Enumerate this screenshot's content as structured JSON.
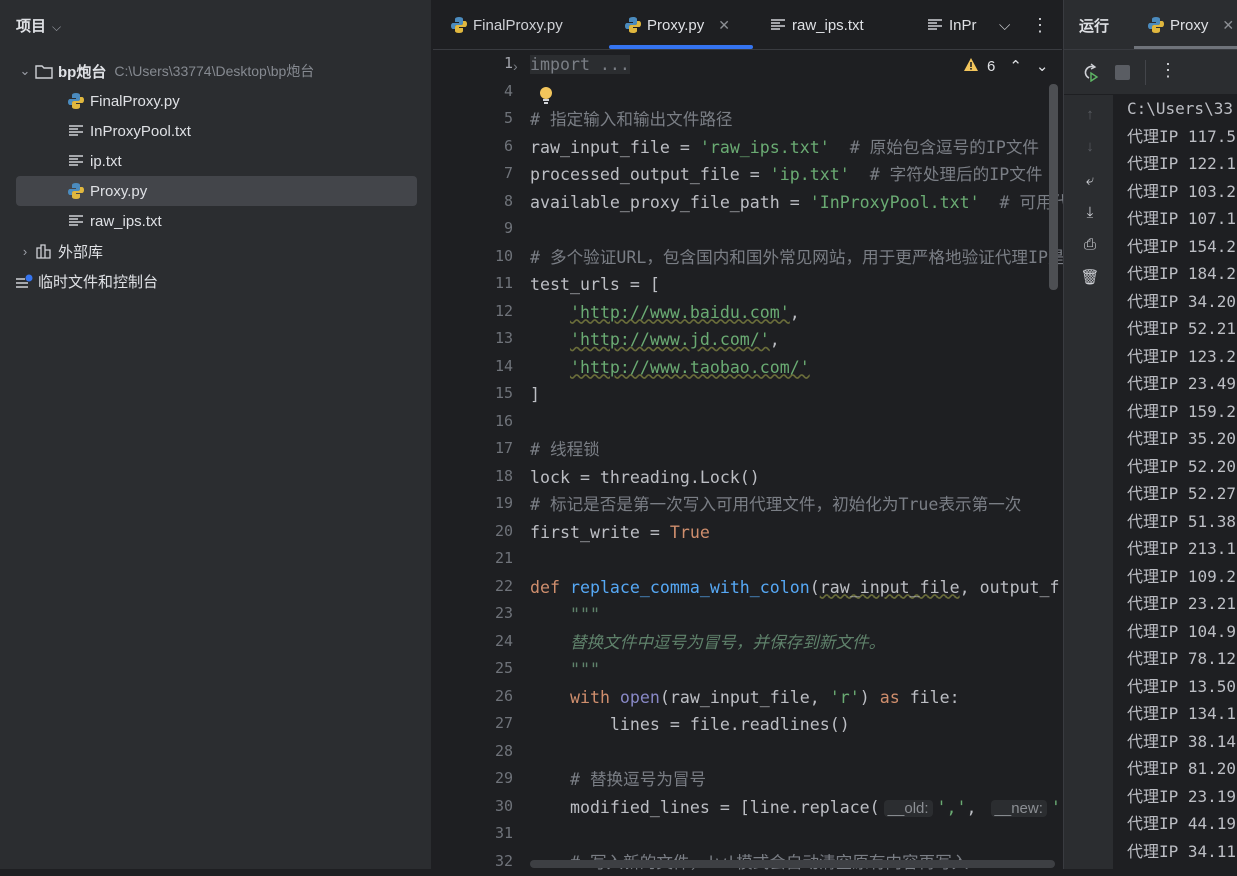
{
  "project": {
    "title": "项目",
    "root": {
      "name": "bp炮台",
      "path": "C:\\Users\\33774\\Desktop\\bp炮台"
    },
    "files": [
      {
        "name": "FinalProxy.py",
        "type": "python"
      },
      {
        "name": "InProxyPool.txt",
        "type": "text"
      },
      {
        "name": "ip.txt",
        "type": "text"
      },
      {
        "name": "Proxy.py",
        "type": "python",
        "selected": true
      },
      {
        "name": "raw_ips.txt",
        "type": "text"
      }
    ],
    "external_libs": "外部库",
    "scratches": "临时文件和控制台"
  },
  "editor": {
    "tabs": [
      {
        "label": "FinalProxy.py",
        "type": "python"
      },
      {
        "label": "Proxy.py",
        "type": "python",
        "active": true
      },
      {
        "label": "raw_ips.txt",
        "type": "text"
      },
      {
        "label": "InPr",
        "type": "text"
      }
    ],
    "warnings_count": "6",
    "lines": [
      {
        "n": "1",
        "t": [
          [
            "fold",
            "import ..."
          ]
        ]
      },
      {
        "n": "4",
        "t": []
      },
      {
        "n": "5",
        "t": [
          [
            "c",
            "# 指定输入和输出文件路径"
          ]
        ]
      },
      {
        "n": "6",
        "t": [
          [
            "p",
            "raw_input_file = "
          ],
          [
            "s",
            "'raw_ips.txt'"
          ],
          [
            "c",
            "  # 原始包含逗号的IP文件"
          ]
        ]
      },
      {
        "n": "7",
        "t": [
          [
            "p",
            "processed_output_file = "
          ],
          [
            "s",
            "'ip.txt'"
          ],
          [
            "c",
            "  # 字符处理后的IP文件"
          ]
        ]
      },
      {
        "n": "8",
        "t": [
          [
            "p",
            "available_proxy_file_path = "
          ],
          [
            "s",
            "'InProxyPool.txt'"
          ],
          [
            "c",
            "  # 可用代"
          ]
        ]
      },
      {
        "n": "9",
        "t": []
      },
      {
        "n": "10",
        "t": [
          [
            "c",
            "# 多个验证URL，包含国内和国外常见网站，用于更严格地验证代理IP是否"
          ]
        ]
      },
      {
        "n": "11",
        "t": [
          [
            "p",
            "test_urls = ["
          ]
        ]
      },
      {
        "n": "12",
        "t": [
          [
            "p",
            "    "
          ],
          [
            "s u",
            "'http://www.baidu.com'"
          ],
          [
            "p",
            ","
          ]
        ]
      },
      {
        "n": "13",
        "t": [
          [
            "p",
            "    "
          ],
          [
            "s u",
            "'http://www.jd.com/'"
          ],
          [
            "p",
            ","
          ]
        ]
      },
      {
        "n": "14",
        "t": [
          [
            "p",
            "    "
          ],
          [
            "s u",
            "'http://www.taobao.com/'"
          ]
        ]
      },
      {
        "n": "15",
        "t": [
          [
            "p",
            "]"
          ]
        ]
      },
      {
        "n": "16",
        "t": []
      },
      {
        "n": "17",
        "t": [
          [
            "c",
            "# 线程锁"
          ]
        ]
      },
      {
        "n": "18",
        "t": [
          [
            "p",
            "lock = threading.Lock()"
          ]
        ]
      },
      {
        "n": "19",
        "t": [
          [
            "c",
            "# 标记是否是第一次写入可用代理文件，初始化为True表示第一次"
          ]
        ]
      },
      {
        "n": "20",
        "t": [
          [
            "p",
            "first_write = "
          ],
          [
            "k",
            "True"
          ]
        ]
      },
      {
        "n": "21",
        "t": []
      },
      {
        "n": "22",
        "t": [
          [
            "k",
            "def "
          ],
          [
            "f",
            "replace_comma_with_colon"
          ],
          [
            "p",
            "("
          ],
          [
            "p u",
            "raw_input_file"
          ],
          [
            "p",
            ", output_f"
          ]
        ]
      },
      {
        "n": "23",
        "t": [
          [
            "d",
            "    \"\"\""
          ]
        ]
      },
      {
        "n": "24",
        "t": [
          [
            "d",
            "    替换文件中逗号为冒号，并保存到新文件。"
          ]
        ]
      },
      {
        "n": "25",
        "t": [
          [
            "d",
            "    \"\"\""
          ]
        ]
      },
      {
        "n": "26",
        "t": [
          [
            "p",
            "    "
          ],
          [
            "k",
            "with "
          ],
          [
            "b",
            "open"
          ],
          [
            "p",
            "(raw_input_file, "
          ],
          [
            "s",
            "'r'"
          ],
          [
            "p",
            ") "
          ],
          [
            "k",
            "as "
          ],
          [
            "p",
            "file:"
          ]
        ]
      },
      {
        "n": "27",
        "t": [
          [
            "p",
            "        lines = file.readlines()"
          ]
        ]
      },
      {
        "n": "28",
        "t": []
      },
      {
        "n": "29",
        "t": [
          [
            "c",
            "    # 替换逗号为冒号"
          ]
        ]
      },
      {
        "n": "30",
        "t": [
          [
            "p",
            "    modified_lines = [line.replace("
          ],
          [
            "h",
            "__old:"
          ],
          [
            "s",
            "','"
          ],
          [
            "p",
            ", "
          ],
          [
            "h",
            "__new:"
          ],
          [
            "s",
            "'"
          ]
        ]
      },
      {
        "n": "31",
        "t": []
      },
      {
        "n": "32",
        "t": [
          [
            "c",
            "    # 写入新的文件，'w'模式会自动清空原有内容再写入"
          ]
        ]
      }
    ]
  },
  "run": {
    "title": "运行",
    "tab": "Proxy",
    "console": [
      "C:\\Users\\33",
      "代理IP 117.5",
      "代理IP 122.1",
      "代理IP 103.2",
      "代理IP 107.1",
      "代理IP 154.2",
      "代理IP 184.2",
      "代理IP 34.20",
      "代理IP 52.21",
      "代理IP 123.2",
      "代理IP 23.49",
      "代理IP 159.2",
      "代理IP 35.20",
      "代理IP 52.20",
      "代理IP 52.27",
      "代理IP 51.38",
      "代理IP 213.1",
      "代理IP 109.2",
      "代理IP 23.21",
      "代理IP 104.9",
      "代理IP 78.12",
      "代理IP 13.50",
      "代理IP 134.1",
      "代理IP 38.14",
      "代理IP 81.20",
      "代理IP 23.19",
      "代理IP 44.19",
      "代理IP 34.11"
    ]
  },
  "colors": {
    "accent": "#3574f0",
    "keyword": "#cf8e6d",
    "string": "#6aab73",
    "comment": "#7a7e85",
    "function": "#56a8f5"
  }
}
